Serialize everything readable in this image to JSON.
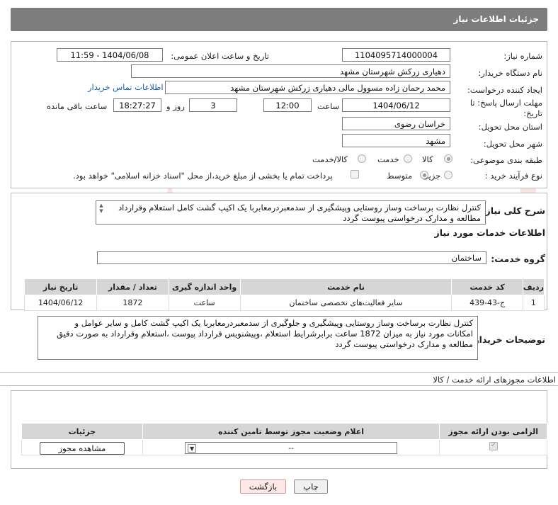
{
  "header": {
    "title": "جزئیات اطلاعات نیاز"
  },
  "form": {
    "need_number_label": "شماره نیاز:",
    "need_number": "1104095714000004",
    "announce_label": "تاریخ و ساعت اعلان عمومی:",
    "announce_value": "1404/06/08 - 11:59",
    "buyer_org_label": "نام دستگاه خریدار:",
    "buyer_org": "دهیاری زرکش  شهرستان مشهد",
    "creator_label": "ایجاد کننده درخواست:",
    "creator": "محمد رحمان زاده مسوول مالی  دهیاری زرکش  شهرستان مشهد",
    "contact_link": "اطلاعات تماس خریدار",
    "deadline_label_1": "مهلت ارسال پاسخ: تا",
    "deadline_label_2": "تاریخ:",
    "deadline_date": "1404/06/12",
    "time_label": "ساعت",
    "deadline_time": "12:00",
    "days_value": "3",
    "days_label": "روز و",
    "remaining_time": "18:27:27",
    "remaining_label": "ساعت باقی مانده",
    "province_label": "استان محل تحویل:",
    "province": "خراسان رضوی",
    "city_label": "شهر محل تحویل:",
    "city": "مشهد",
    "category_label": "طبقه بندی موضوعی:",
    "category_options": [
      "کالا",
      "خدمت",
      "کالا/خدمت"
    ],
    "process_label": "نوع فرآیند خرید :",
    "process_options": [
      "جزیی",
      "متوسط"
    ],
    "treasury_note": "پرداخت تمام یا بخشی از مبلغ خرید،از محل \"اسناد خزانه اسلامی\" خواهد بود."
  },
  "summary": {
    "label": "شرح کلی نیاز:",
    "text_line1": "کنترل نظارت برساخت وساز روستایی وپیشگیری از سدمعبردرمعابربا یک اکیپ گشت کامل استعلام وقرارداد",
    "text_line2": "مطالعه و مدارک درخواستی پیوست گردد"
  },
  "services": {
    "section_title": "اطلاعات خدمات مورد نیاز",
    "group_label": "گروه خدمت:",
    "group_value": "ساختمان",
    "columns": [
      "ردیف",
      "کد خدمت",
      "نام خدمت",
      "واحد اندازه گیری",
      "تعداد / مقدار",
      "تاریخ نیاز"
    ],
    "rows": [
      {
        "row": "1",
        "code": "ج-43-439",
        "name": "سایر فعالیت‌های تخصصی ساختمان",
        "unit": "ساعت",
        "qty": "1872",
        "date": "1404/06/12"
      }
    ]
  },
  "buyer_notes": {
    "label": "توضیحات خریدار:",
    "line1": "کنترل نظارت برساخت وساز روستایی وپیشگیری و جلوگیری از  سدمعبردرمعابربا  یک اکیپ گشت کامل و سایر عوامل و",
    "line2": "امکانات مورد نیاز به میزان 1872 ساعت برابرشرایط  استعلام ،وپیشنویس قرارداد پیوست ،استعلام وقرارداد به صورت دقیق",
    "line3": "مطالعه و مدارک درخواستی پیوست گردد"
  },
  "permits": {
    "section_title": "اطلاعات مجوزهای ارائه خدمت / کالا",
    "columns": [
      "الزامی بودن ارائه مجوز",
      "اعلام وضعیت مجوز توسط تامین کننده",
      "جزئیات"
    ],
    "select_value": "--",
    "view_button": "مشاهده مجوز"
  },
  "footer": {
    "print_button": "چاپ",
    "back_button": "بازگشت"
  },
  "colors": {
    "header_bg": "#7d7d7d",
    "link": "#1a5fb4",
    "table_header": "#d6d6d6",
    "back_button": "#fde8e8"
  }
}
